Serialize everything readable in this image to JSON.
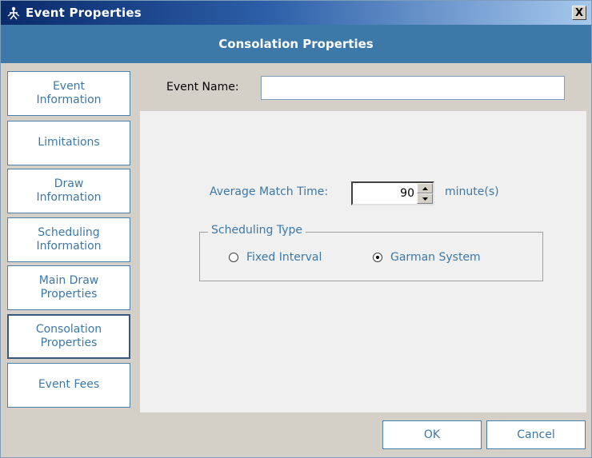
{
  "window": {
    "title": "Event Properties",
    "close_label": "X"
  },
  "header": {
    "title": "Consolation Properties"
  },
  "nav": {
    "items": [
      {
        "label": "Event\nInformation",
        "active": false
      },
      {
        "label": "Limitations",
        "active": false
      },
      {
        "label": "Draw\nInformation",
        "active": false
      },
      {
        "label": "Scheduling\nInformation",
        "active": false
      },
      {
        "label": "Main Draw\nProperties",
        "active": false
      },
      {
        "label": "Consolation\nProperties",
        "active": true
      },
      {
        "label": "Event Fees",
        "active": false
      }
    ]
  },
  "form": {
    "event_name_label": "Event Name:",
    "event_name_value": "",
    "avg_match_time_label": "Average Match Time:",
    "avg_match_time_value": "90",
    "minutes_label": "minute(s)",
    "scheduling_type": {
      "legend": "Scheduling Type",
      "options": [
        {
          "label": "Fixed Interval",
          "selected": false
        },
        {
          "label": "Garman System",
          "selected": true
        }
      ]
    }
  },
  "buttons": {
    "ok_label": "OK",
    "cancel_label": "Cancel"
  },
  "colors": {
    "header_band": "#3c78a8",
    "accent_text": "#3c78a8",
    "panel_bg": "#f0f0f0"
  }
}
